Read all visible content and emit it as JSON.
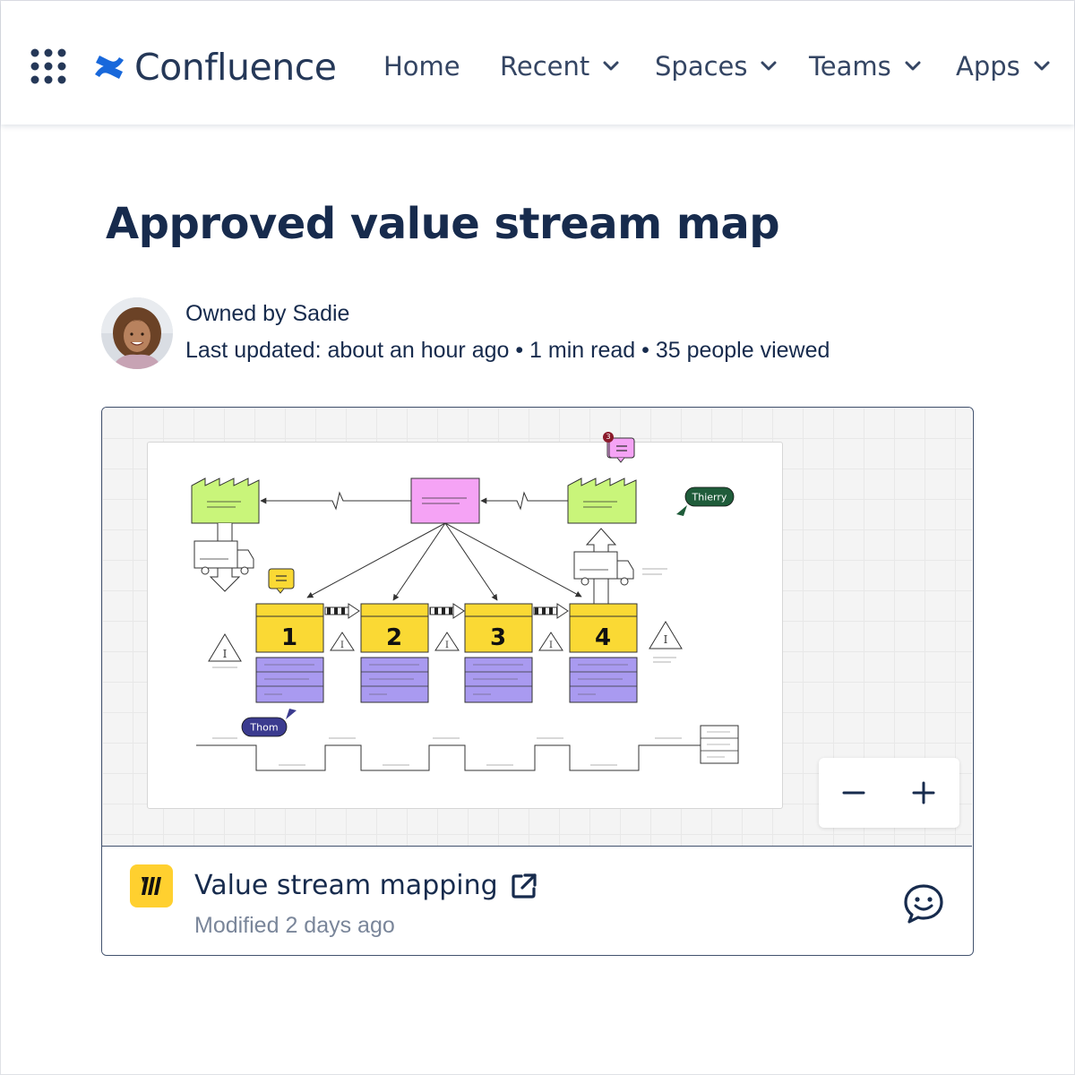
{
  "app": {
    "name": "Confluence",
    "brand_color": "#1868db",
    "nav_text_color": "#344563"
  },
  "nav": {
    "items": [
      {
        "label": "Home"
      },
      {
        "label": "Recent"
      },
      {
        "label": "Spaces"
      },
      {
        "label": "Teams"
      },
      {
        "label": "Apps"
      }
    ]
  },
  "page": {
    "title": "Approved value stream map",
    "owner_line": "Owned by Sadie",
    "meta_line": "Last updated: about an hour ago • 1 min read • 35 people viewed"
  },
  "embed": {
    "board": {
      "process_steps": [
        "1",
        "2",
        "3",
        "4"
      ],
      "cursors": [
        {
          "label": "Thierry",
          "color": "#1f5c3a"
        },
        {
          "label": "Thom",
          "color": "#3b3b8f"
        }
      ],
      "comment_count": "3",
      "colors": {
        "factory": "#c9f57a",
        "control": "#f5a3f5",
        "process": "#fad934",
        "data_box": "#a99af0"
      }
    },
    "zoom": {
      "out_icon": "minus-icon",
      "in_icon": "plus-icon"
    },
    "file": {
      "title": "Value stream mapping",
      "modified": "Modified 2 days ago",
      "logo_color": "#ffd02f"
    }
  }
}
